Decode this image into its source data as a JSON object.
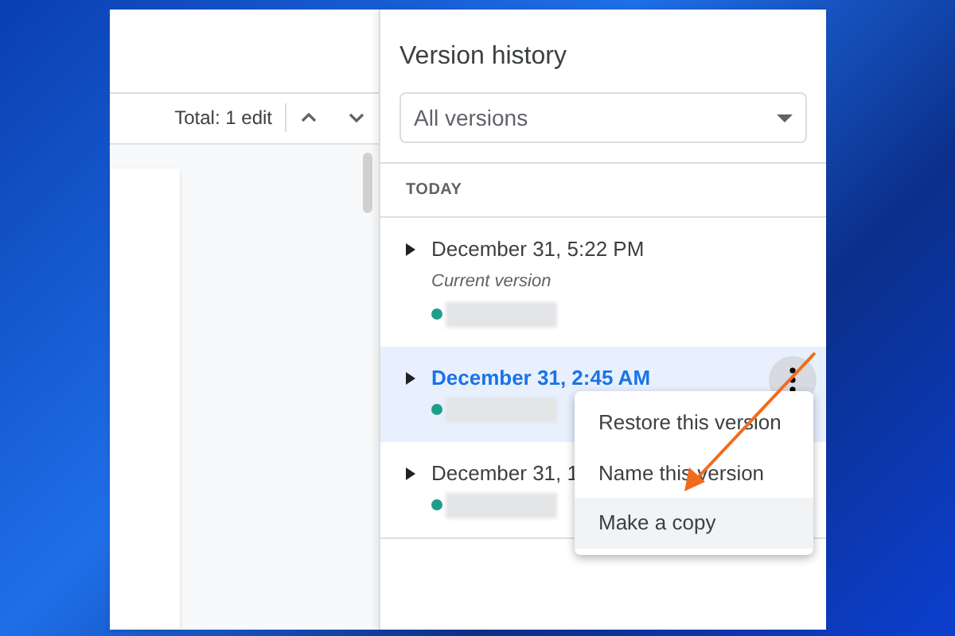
{
  "toolbar": {
    "total": "Total: 1 edit"
  },
  "panel": {
    "title": "Version history",
    "filter": {
      "value": "All versions"
    },
    "section": "TODAY",
    "versions": [
      {
        "date": "December 31, 5:22 PM",
        "note": "Current version",
        "selected": false
      },
      {
        "date": "December 31, 2:45 AM",
        "selected": true
      },
      {
        "date": "December 31, 1",
        "selected": false
      }
    ]
  },
  "menu": {
    "items": [
      {
        "label": "Restore this version",
        "selected": false
      },
      {
        "label": "Name this version",
        "selected": false
      },
      {
        "label": "Make a copy",
        "selected": true
      }
    ]
  }
}
